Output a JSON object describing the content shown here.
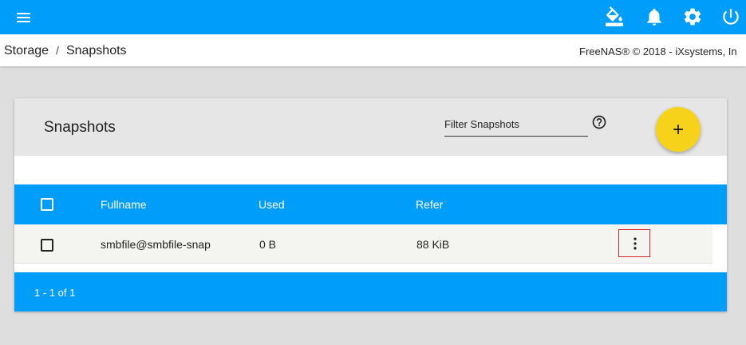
{
  "topbar": {
    "menu_icon": "hamburger-menu-icon",
    "icons": [
      "paint-bucket-icon",
      "bell-icon",
      "gear-icon",
      "power-icon"
    ]
  },
  "breadcrumb": {
    "items": [
      "Storage",
      "Snapshots"
    ],
    "separator": "/"
  },
  "copyright": "FreeNAS® © 2018 - iXsystems, In",
  "card": {
    "title": "Snapshots",
    "filter_placeholder": "Filter Snapshots",
    "help_icon": "help-circle-icon",
    "add_icon": "plus-icon"
  },
  "table": {
    "columns": [
      "Fullname",
      "Used",
      "Refer"
    ],
    "rows": [
      {
        "fullname": "smbfile@smbfile-snap",
        "used": "0 B",
        "refer": "88 KiB"
      }
    ],
    "pagination": "1 - 1 of 1"
  },
  "colors": {
    "primary": "#009dfa",
    "accent": "#f7d21a",
    "background": "#dedede"
  }
}
